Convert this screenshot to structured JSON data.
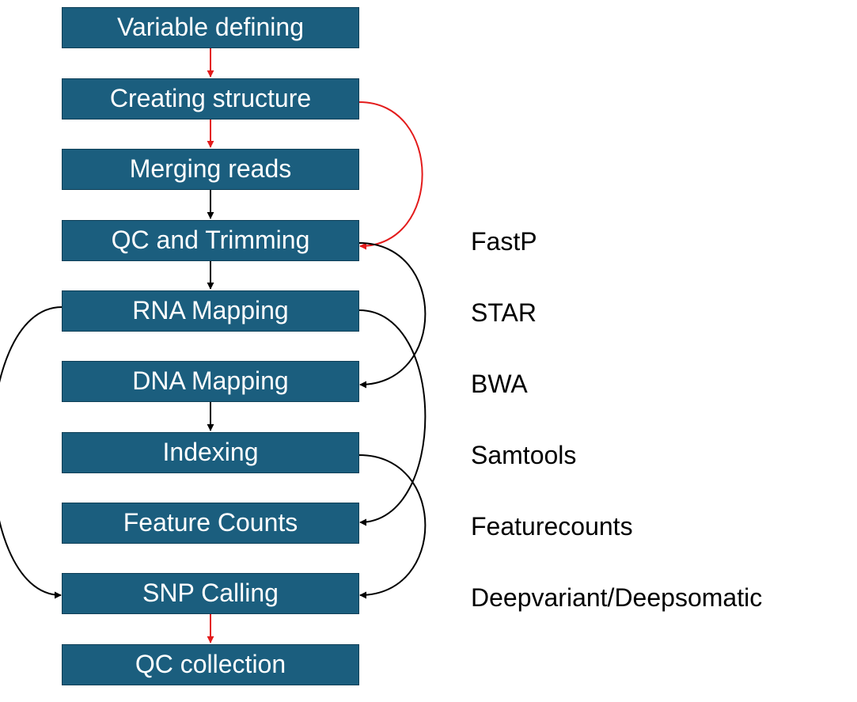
{
  "steps": [
    {
      "label": "Variable defining"
    },
    {
      "label": "Creating structure"
    },
    {
      "label": "Merging reads"
    },
    {
      "label": "QC and Trimming"
    },
    {
      "label": "RNA Mapping"
    },
    {
      "label": "DNA Mapping"
    },
    {
      "label": "Indexing"
    },
    {
      "label": "Feature Counts"
    },
    {
      "label": "SNP Calling"
    },
    {
      "label": "QC collection"
    }
  ],
  "tools": [
    {
      "label": "FastP"
    },
    {
      "label": "STAR"
    },
    {
      "label": "BWA"
    },
    {
      "label": "Samtools"
    },
    {
      "label": "Featurecounts"
    },
    {
      "label": "Deepvariant/Deepsomatic"
    }
  ],
  "colors": {
    "step_fill": "#1b5e7e",
    "arrow_primary": "#e31b1b",
    "arrow_secondary": "#000000"
  }
}
